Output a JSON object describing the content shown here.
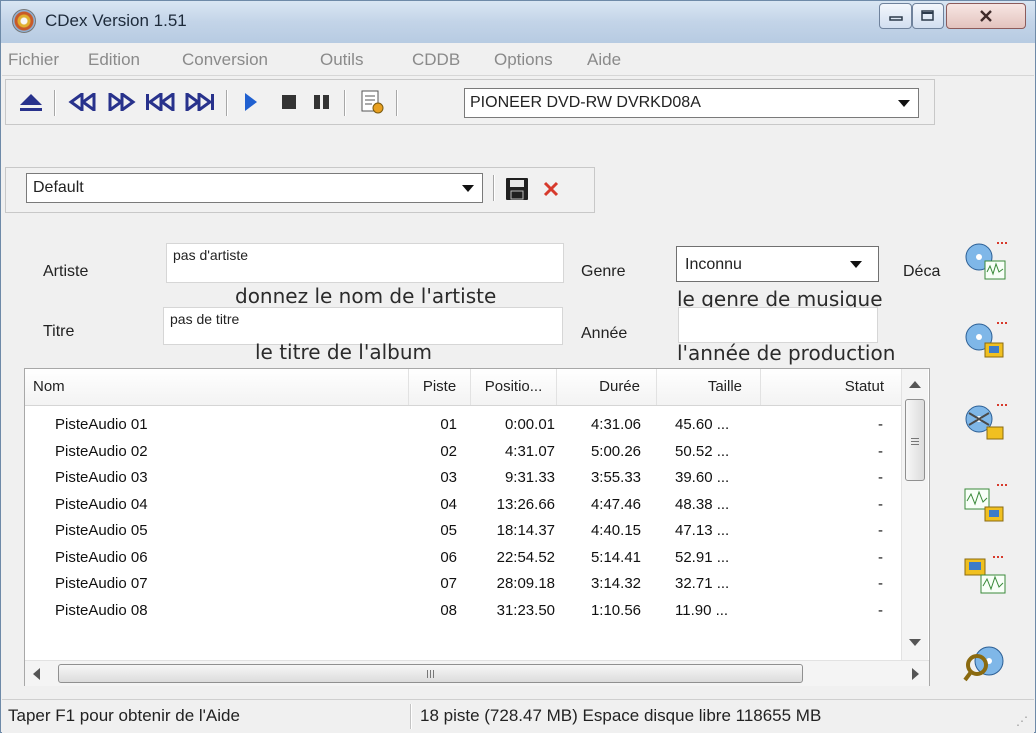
{
  "window": {
    "title": "CDex Version 1.51"
  },
  "menu": [
    "Fichier",
    "Edition",
    "Conversion",
    "Outils",
    "CDDB",
    "Options",
    "Aide"
  ],
  "toolbar": {
    "drive": "PIONEER DVD-RW  DVRKD08A",
    "profile": "Default"
  },
  "form": {
    "artist_label": "Artiste",
    "artist_value": "pas d'artiste",
    "title_label": "Titre",
    "title_value": "pas de titre",
    "genre_label": "Genre",
    "genre_value": "Inconnu",
    "year_label": "Année",
    "offset_label_partial": "Déca"
  },
  "annotations": {
    "artist": "donnez le nom de l'artiste",
    "genre": "le genre de musique",
    "title": "le titre de l'album",
    "year": "l'année de production"
  },
  "table": {
    "headers": [
      "Nom",
      "Piste",
      "Positio...",
      "Durée",
      "Taille",
      "Statut"
    ],
    "rows": [
      [
        "PisteAudio 01",
        "01",
        "0:00.01",
        "4:31.06",
        "45.60 ...",
        "-"
      ],
      [
        "PisteAudio 02",
        "02",
        "4:31.07",
        "5:00.26",
        "50.52 ...",
        "-"
      ],
      [
        "PisteAudio 03",
        "03",
        "9:31.33",
        "3:55.33",
        "39.60 ...",
        "-"
      ],
      [
        "PisteAudio 04",
        "04",
        "13:26.66",
        "4:47.46",
        "48.38 ...",
        "-"
      ],
      [
        "PisteAudio 05",
        "05",
        "18:14.37",
        "4:40.15",
        "47.13 ...",
        "-"
      ],
      [
        "PisteAudio 06",
        "06",
        "22:54.52",
        "5:14.41",
        "52.91 ...",
        "-"
      ],
      [
        "PisteAudio 07",
        "07",
        "28:09.18",
        "3:14.32",
        "32.71 ...",
        "-"
      ],
      [
        "PisteAudio 08",
        "08",
        "31:23.50",
        "1:10.56",
        "11.90 ...",
        "-"
      ]
    ]
  },
  "status": {
    "help": "Taper F1 pour obtenir de l'Aide",
    "info": "18 piste (728.47 MB) Espace disque libre 118655 MB"
  },
  "colors": {
    "title_bar": "#c3d4e8",
    "toolbar_icon": "#28328c",
    "accent_red": "#d73a2c",
    "accent_yellow": "#f0c020"
  },
  "icons": [
    "eject-icon",
    "rewind-icon",
    "fast-forward-icon",
    "previous-track-icon",
    "next-track-icon",
    "play-icon",
    "stop-icon",
    "pause-icon",
    "track-info-icon",
    "save-icon",
    "delete-icon"
  ]
}
